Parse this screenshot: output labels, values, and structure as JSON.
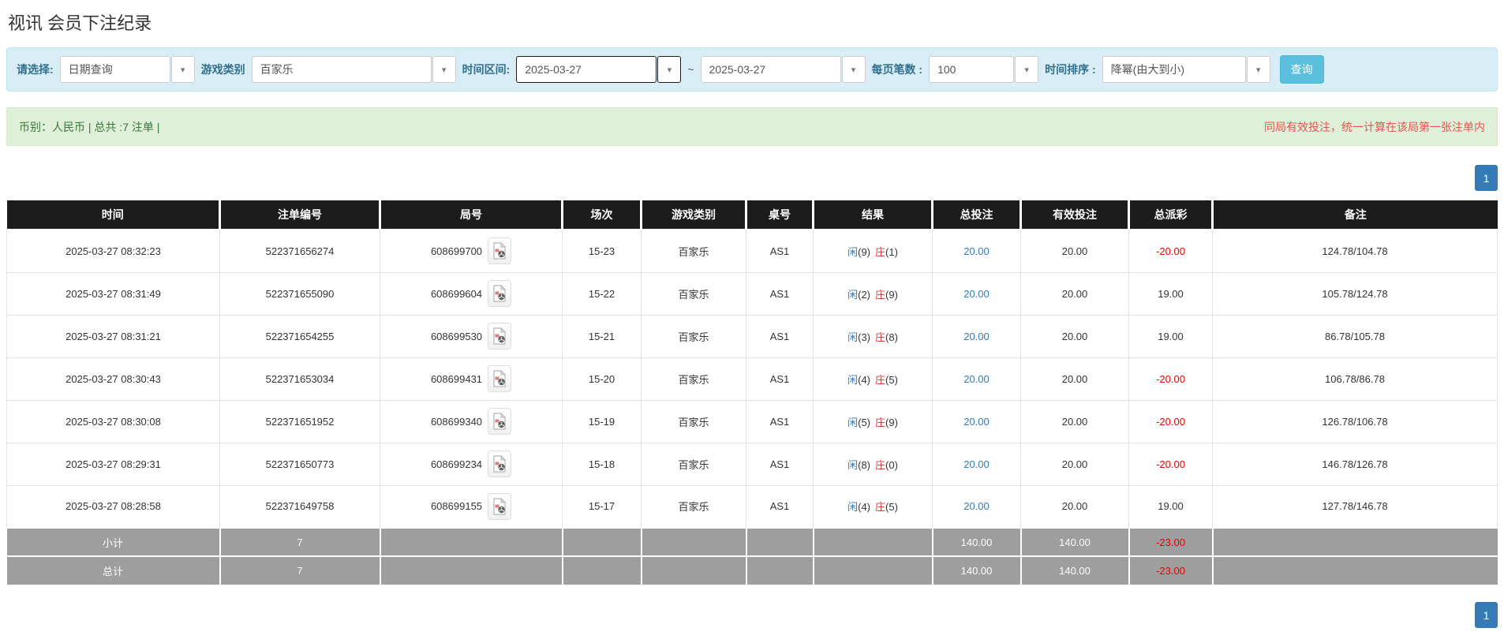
{
  "page": {
    "title": "视讯 会员下注纪录"
  },
  "filters": {
    "select_label": "请选择:",
    "select_value": "日期查询",
    "game_label": "游戏类别",
    "game_value": "百家乐",
    "range_label": "时间区间:",
    "date_from": "2025-03-27",
    "tilde": "~",
    "date_to": "2025-03-27",
    "pagesize_label": "每页笔数 :",
    "pagesize_value": "100",
    "sort_label": "时间排序 :",
    "sort_value": "降幂(由大到小)",
    "query_button": "查询",
    "caret_icon": "▾"
  },
  "summary": {
    "left": "币别：人民币 | 总共 :7 注单 |",
    "right": "同局有效投注，统一计算在该局第一张注单内"
  },
  "pagination": {
    "page": "1"
  },
  "table": {
    "headers": [
      "时间",
      "注单编号",
      "局号",
      "场次",
      "游戏类别",
      "桌号",
      "结果",
      "总投注",
      "有效投注",
      "总派彩",
      "备注"
    ],
    "rows": [
      {
        "time": "2025-03-27 08:32:23",
        "bet_id": "522371656274",
        "round_id": "608699700",
        "session": "15-23",
        "game": "百家乐",
        "table_no": "AS1",
        "player": "闲",
        "player_pts": "(9)",
        "banker": "庄",
        "banker_pts": "(1)",
        "total_bet": "20.00",
        "valid_bet": "20.00",
        "payout": "-20.00",
        "note": "124.78/104.78"
      },
      {
        "time": "2025-03-27 08:31:49",
        "bet_id": "522371655090",
        "round_id": "608699604",
        "session": "15-22",
        "game": "百家乐",
        "table_no": "AS1",
        "player": "闲",
        "player_pts": "(2)",
        "banker": "庄",
        "banker_pts": "(9)",
        "total_bet": "20.00",
        "valid_bet": "20.00",
        "payout": "19.00",
        "note": "105.78/124.78"
      },
      {
        "time": "2025-03-27 08:31:21",
        "bet_id": "522371654255",
        "round_id": "608699530",
        "session": "15-21",
        "game": "百家乐",
        "table_no": "AS1",
        "player": "闲",
        "player_pts": "(3)",
        "banker": "庄",
        "banker_pts": "(8)",
        "total_bet": "20.00",
        "valid_bet": "20.00",
        "payout": "19.00",
        "note": "86.78/105.78"
      },
      {
        "time": "2025-03-27 08:30:43",
        "bet_id": "522371653034",
        "round_id": "608699431",
        "session": "15-20",
        "game": "百家乐",
        "table_no": "AS1",
        "player": "闲",
        "player_pts": "(4)",
        "banker": "庄",
        "banker_pts": "(5)",
        "total_bet": "20.00",
        "valid_bet": "20.00",
        "payout": "-20.00",
        "note": "106.78/86.78"
      },
      {
        "time": "2025-03-27 08:30:08",
        "bet_id": "522371651952",
        "round_id": "608699340",
        "session": "15-19",
        "game": "百家乐",
        "table_no": "AS1",
        "player": "闲",
        "player_pts": "(5)",
        "banker": "庄",
        "banker_pts": "(9)",
        "total_bet": "20.00",
        "valid_bet": "20.00",
        "payout": "-20.00",
        "note": "126.78/106.78"
      },
      {
        "time": "2025-03-27 08:29:31",
        "bet_id": "522371650773",
        "round_id": "608699234",
        "session": "15-18",
        "game": "百家乐",
        "table_no": "AS1",
        "player": "闲",
        "player_pts": "(8)",
        "banker": "庄",
        "banker_pts": "(0)",
        "total_bet": "20.00",
        "valid_bet": "20.00",
        "payout": "-20.00",
        "note": "146.78/126.78"
      },
      {
        "time": "2025-03-27 08:28:58",
        "bet_id": "522371649758",
        "round_id": "608699155",
        "session": "15-17",
        "game": "百家乐",
        "table_no": "AS1",
        "player": "闲",
        "player_pts": "(4)",
        "banker": "庄",
        "banker_pts": "(5)",
        "total_bet": "20.00",
        "valid_bet": "20.00",
        "payout": "19.00",
        "note": "127.78/146.78"
      }
    ],
    "footer_rows": [
      {
        "label": "小计",
        "count": "7",
        "total_bet": "140.00",
        "valid_bet": "140.00",
        "payout": "-23.00"
      },
      {
        "label": "总计",
        "count": "7",
        "total_bet": "140.00",
        "valid_bet": "140.00",
        "payout": "-23.00"
      }
    ]
  },
  "colors": {
    "accent": "#337ab7",
    "query_btn": "#5bc0de",
    "filter_bg": "#d9edf7",
    "filter_border": "#bce8f1",
    "filter_label": "#31708f",
    "success_bg": "#dff0d8",
    "success_text": "#3c763d",
    "warning_red": "#e85352",
    "negative_red": "#e60000",
    "player_blue": "#337ab7",
    "banker_red": "#d43f3a",
    "header_bg": "#1c1c1c",
    "footer_bg": "#9e9e9e"
  }
}
